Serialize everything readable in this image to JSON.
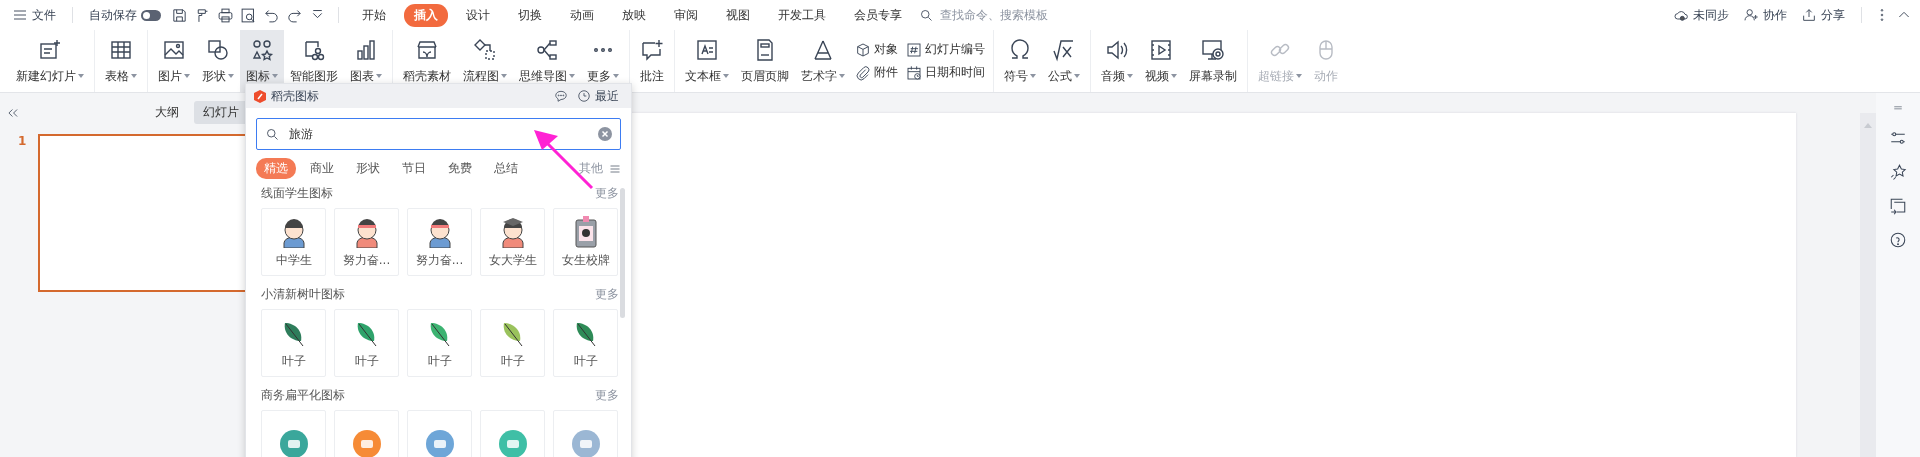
{
  "top_bar": {
    "menu": "文件",
    "autosave": {
      "label": "自动保存",
      "on": false
    },
    "tabs": [
      {
        "label": "开始",
        "selected": false
      },
      {
        "label": "插入",
        "selected": true
      },
      {
        "label": "设计",
        "selected": false
      },
      {
        "label": "切换",
        "selected": false
      },
      {
        "label": "动画",
        "selected": false
      },
      {
        "label": "放映",
        "selected": false
      },
      {
        "label": "审阅",
        "selected": false
      },
      {
        "label": "视图",
        "selected": false
      },
      {
        "label": "开发工具",
        "selected": false
      },
      {
        "label": "会员专享",
        "selected": false
      }
    ],
    "search": {
      "placeholder": "查找命令、搜索模板"
    },
    "actions": [
      "未同步",
      "协作",
      "分享"
    ]
  },
  "ribbon": {
    "groups": [
      {
        "items": [
          {
            "kind": "large",
            "label": "新建幻灯片",
            "caret": true,
            "selected": false,
            "disabled": false
          }
        ]
      },
      {
        "items": [
          {
            "kind": "large",
            "label": "表格",
            "caret": true,
            "selected": false,
            "disabled": false
          }
        ]
      },
      {
        "items": [
          {
            "kind": "large",
            "label": "图片",
            "caret": true,
            "selected": false,
            "disabled": false
          },
          {
            "kind": "large",
            "label": "形状",
            "caret": true,
            "selected": false,
            "disabled": false
          },
          {
            "kind": "large",
            "label": "图标",
            "caret": true,
            "selected": true,
            "disabled": false
          },
          {
            "kind": "large",
            "label": "智能图形",
            "caret": false,
            "selected": false,
            "disabled": false
          },
          {
            "kind": "large",
            "label": "图表",
            "caret": true,
            "selected": false,
            "disabled": false
          }
        ]
      },
      {
        "items": [
          {
            "kind": "large",
            "label": "稻壳素材",
            "caret": false,
            "selected": false,
            "disabled": false
          },
          {
            "kind": "large",
            "label": "流程图",
            "caret": true,
            "selected": false,
            "disabled": false
          },
          {
            "kind": "large",
            "label": "思维导图",
            "caret": true,
            "selected": false,
            "disabled": false
          },
          {
            "kind": "large",
            "label": "更多",
            "caret": true,
            "selected": false,
            "disabled": false
          }
        ]
      },
      {
        "items": [
          {
            "kind": "large",
            "label": "批注",
            "caret": false,
            "selected": false,
            "disabled": false
          }
        ]
      },
      {
        "items": [
          {
            "kind": "large",
            "label": "文本框",
            "caret": true,
            "selected": false,
            "disabled": false
          },
          {
            "kind": "large",
            "label": "页眉页脚",
            "caret": false,
            "selected": false,
            "disabled": false
          },
          {
            "kind": "large",
            "label": "艺术字",
            "caret": true,
            "selected": false,
            "disabled": false
          },
          {
            "kind": "stack",
            "items": [
              {
                "label": "对象"
              },
              {
                "label": "附件"
              }
            ]
          },
          {
            "kind": "stack",
            "items": [
              {
                "label": "幻灯片编号"
              },
              {
                "label": "日期和时间"
              }
            ]
          }
        ]
      },
      {
        "items": [
          {
            "kind": "large",
            "label": "符号",
            "caret": true,
            "selected": false,
            "disabled": false
          },
          {
            "kind": "large",
            "label": "公式",
            "caret": true,
            "selected": false,
            "disabled": false
          }
        ]
      },
      {
        "items": [
          {
            "kind": "large",
            "label": "音频",
            "caret": true,
            "selected": false,
            "disabled": false
          },
          {
            "kind": "large",
            "label": "视频",
            "caret": true,
            "selected": false,
            "disabled": false
          },
          {
            "kind": "large",
            "label": "屏幕录制",
            "caret": false,
            "selected": false,
            "disabled": false
          }
        ]
      },
      {
        "items": [
          {
            "kind": "large",
            "label": "超链接",
            "caret": true,
            "selected": false,
            "disabled": true
          },
          {
            "kind": "large",
            "label": "动作",
            "caret": false,
            "selected": false,
            "disabled": true
          }
        ]
      }
    ]
  },
  "slide_pane": {
    "tabs": [
      {
        "label": "大纲",
        "selected": false
      },
      {
        "label": "幻灯片",
        "selected": true
      }
    ],
    "slides": [
      {
        "number": "1",
        "selected": true
      }
    ]
  },
  "icon_panel": {
    "title": "稻壳图标",
    "recent": "最近",
    "search": {
      "value": "旅游"
    },
    "filters": [
      {
        "label": "精选",
        "selected": true
      },
      {
        "label": "商业",
        "selected": false
      },
      {
        "label": "形状",
        "selected": false
      },
      {
        "label": "节日",
        "selected": false
      },
      {
        "label": "免费",
        "selected": false
      },
      {
        "label": "总结",
        "selected": false
      }
    ],
    "other_filter": "其他",
    "sections": [
      {
        "title": "线面学生图标",
        "more": "更多",
        "items": [
          {
            "label": "中学生"
          },
          {
            "label": "努力奋..."
          },
          {
            "label": "努力奋..."
          },
          {
            "label": "女大学生"
          },
          {
            "label": "女生校牌"
          }
        ]
      },
      {
        "title": "小清新树叶图标",
        "more": "更多",
        "items": [
          {
            "label": "叶子"
          },
          {
            "label": "叶子"
          },
          {
            "label": "叶子"
          },
          {
            "label": "叶子"
          },
          {
            "label": "叶子"
          }
        ]
      },
      {
        "title": "商务扁平化图标",
        "more": "更多",
        "items": [
          {
            "kind": "icon"
          },
          {
            "kind": "icon"
          },
          {
            "kind": "icon"
          },
          {
            "kind": "icon"
          },
          {
            "kind": "icon"
          }
        ]
      }
    ]
  }
}
